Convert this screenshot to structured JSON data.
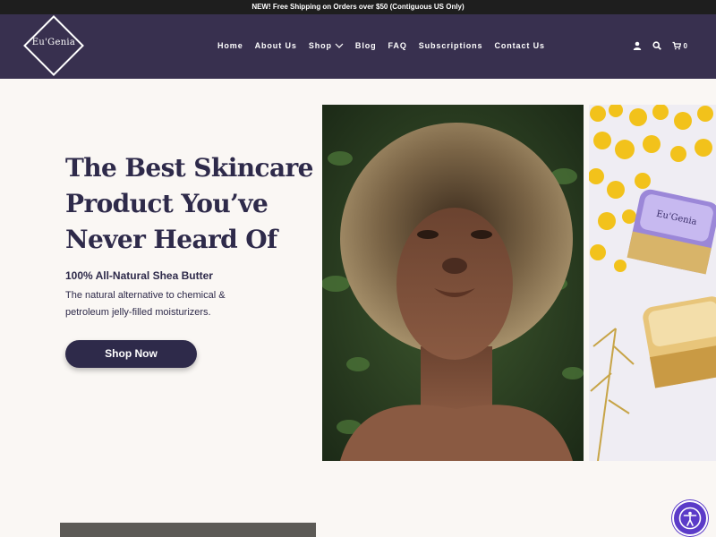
{
  "announcement": "NEW! Free Shipping on Orders over $50 (Contiguous US Only)",
  "brand": {
    "logo_text": "Eu'Genia"
  },
  "nav": {
    "items": [
      {
        "label": "Home"
      },
      {
        "label": "About Us"
      },
      {
        "label": "Shop"
      },
      {
        "label": "Blog"
      },
      {
        "label": "FAQ"
      },
      {
        "label": "Subscriptions"
      },
      {
        "label": "Contact Us"
      }
    ],
    "cart_count": "0",
    "icons": [
      "user-icon",
      "search-icon",
      "cart-icon"
    ]
  },
  "hero": {
    "title": "The Best Skincare Product You’ve Never Heard Of",
    "subtitle": "100% All-Natural Shea Butter",
    "description": "The natural alternative to chemical & petroleum jelly-filled moisturizers.",
    "cta": "Shop Now"
  },
  "product_jar_label": "Eu'Genia",
  "colors": {
    "header_bg": "#38304f",
    "announcement_bg": "#1e1e1e",
    "primary_text": "#2e2a4a",
    "page_bg": "#faf7f4",
    "accessibility_button": "#5b3bc8"
  }
}
